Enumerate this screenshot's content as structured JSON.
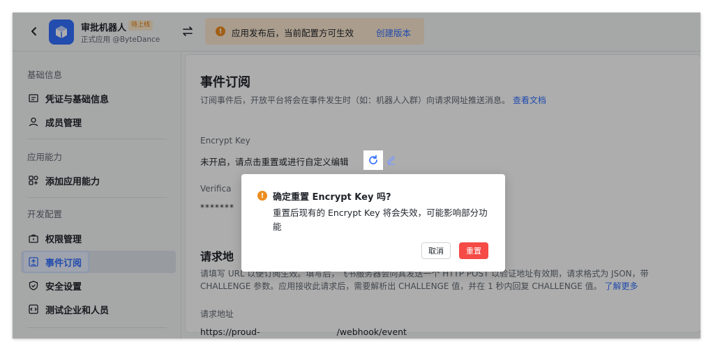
{
  "header": {
    "app_name": "审批机器人",
    "app_badge": "待上线",
    "app_sub": "正式应用 @ByteDance",
    "notice_text": "应用发布后，当前配置方可生效",
    "notice_link": "创建版本"
  },
  "sidebar": {
    "groups": [
      "基础信息",
      "应用能力",
      "开发配置"
    ],
    "items": [
      {
        "label": "凭证与基础信息",
        "icon": "credential-icon"
      },
      {
        "label": "成员管理",
        "icon": "user-icon"
      },
      {
        "label": "添加应用能力",
        "icon": "apps-icon"
      },
      {
        "label": "权限管理",
        "icon": "permission-icon"
      },
      {
        "label": "事件订阅",
        "icon": "event-icon"
      },
      {
        "label": "安全设置",
        "icon": "shield-icon"
      },
      {
        "label": "测试企业和人员",
        "icon": "code-icon"
      }
    ],
    "active_index": 4
  },
  "main": {
    "title": "事件订阅",
    "desc": "订阅事件后，开放平台将会在事件发生时（如：机器人入群）向请求网址推送消息。",
    "desc_link": "查看文档",
    "encrypt_label": "Encrypt Key",
    "encrypt_text": "未开启，请点击重置或进行自定义编辑",
    "verif_label": "Verifica",
    "verif_value": "*******",
    "sec2_title": "请求地",
    "sec2_desc": "请填写 URL 以便订阅生效。填写后，飞书服务器会向其发送一个 HTTP POST 以验证地址有效期，请求格式为 JSON，带 CHALLENGE 参数。应用接收此请求后，需要解析出 CHALLENGE 值，并在 1 秒内回复 CHALLENGE 值。",
    "sec2_link": "了解更多",
    "url_label": "请求地址",
    "url_prefix": "https://proud-",
    "url_suffix": "/webhook/event"
  },
  "dialog": {
    "title": "确定重置 Encrypt Key 吗?",
    "body": "重置后现有的 Encrypt Key 将会失效，可能影响部分功能",
    "cancel": "取消",
    "confirm": "重置"
  },
  "colors": {
    "accent": "#3370ff",
    "danger": "#f54a45",
    "warning": "#ed8d1f"
  }
}
